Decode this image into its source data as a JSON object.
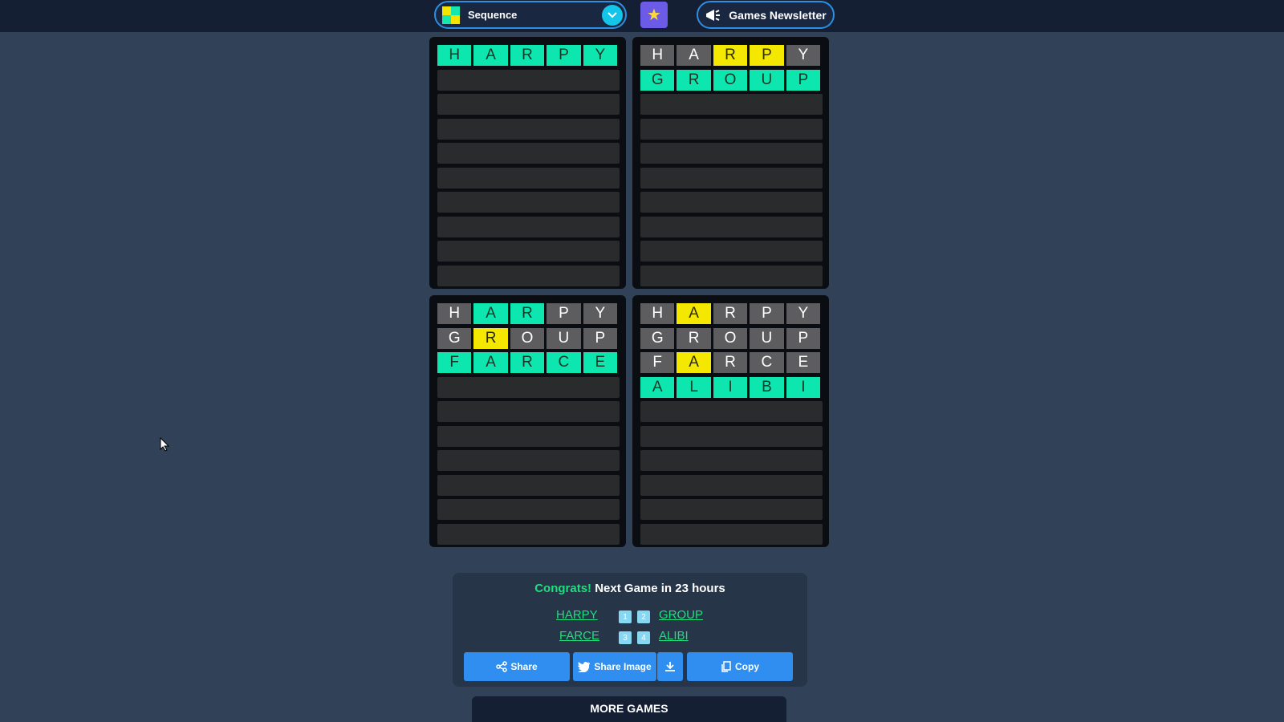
{
  "header": {
    "game_name": "Sequence",
    "newsletter_label": "Games Newsletter"
  },
  "boards": [
    {
      "rows": [
        [
          {
            "l": "H",
            "s": "green"
          },
          {
            "l": "A",
            "s": "green"
          },
          {
            "l": "R",
            "s": "green"
          },
          {
            "l": "P",
            "s": "green"
          },
          {
            "l": "Y",
            "s": "green"
          }
        ]
      ],
      "empty_rows": 9
    },
    {
      "rows": [
        [
          {
            "l": "H",
            "s": "gray"
          },
          {
            "l": "A",
            "s": "gray"
          },
          {
            "l": "R",
            "s": "yellow"
          },
          {
            "l": "P",
            "s": "yellow"
          },
          {
            "l": "Y",
            "s": "gray"
          }
        ],
        [
          {
            "l": "G",
            "s": "green"
          },
          {
            "l": "R",
            "s": "green"
          },
          {
            "l": "O",
            "s": "green"
          },
          {
            "l": "U",
            "s": "green"
          },
          {
            "l": "P",
            "s": "green"
          }
        ]
      ],
      "empty_rows": 8
    },
    {
      "rows": [
        [
          {
            "l": "H",
            "s": "gray"
          },
          {
            "l": "A",
            "s": "green"
          },
          {
            "l": "R",
            "s": "green"
          },
          {
            "l": "P",
            "s": "gray"
          },
          {
            "l": "Y",
            "s": "gray"
          }
        ],
        [
          {
            "l": "G",
            "s": "gray"
          },
          {
            "l": "R",
            "s": "yellow"
          },
          {
            "l": "O",
            "s": "gray"
          },
          {
            "l": "U",
            "s": "gray"
          },
          {
            "l": "P",
            "s": "gray"
          }
        ],
        [
          {
            "l": "F",
            "s": "green"
          },
          {
            "l": "A",
            "s": "green"
          },
          {
            "l": "R",
            "s": "green"
          },
          {
            "l": "C",
            "s": "green"
          },
          {
            "l": "E",
            "s": "green"
          }
        ]
      ],
      "empty_rows": 7
    },
    {
      "rows": [
        [
          {
            "l": "H",
            "s": "gray"
          },
          {
            "l": "A",
            "s": "yellow"
          },
          {
            "l": "R",
            "s": "gray"
          },
          {
            "l": "P",
            "s": "gray"
          },
          {
            "l": "Y",
            "s": "gray"
          }
        ],
        [
          {
            "l": "G",
            "s": "gray"
          },
          {
            "l": "R",
            "s": "gray"
          },
          {
            "l": "O",
            "s": "gray"
          },
          {
            "l": "U",
            "s": "gray"
          },
          {
            "l": "P",
            "s": "gray"
          }
        ],
        [
          {
            "l": "F",
            "s": "gray"
          },
          {
            "l": "A",
            "s": "yellow"
          },
          {
            "l": "R",
            "s": "gray"
          },
          {
            "l": "C",
            "s": "gray"
          },
          {
            "l": "E",
            "s": "gray"
          }
        ],
        [
          {
            "l": "A",
            "s": "green"
          },
          {
            "l": "L",
            "s": "green"
          },
          {
            "l": "I",
            "s": "green"
          },
          {
            "l": "B",
            "s": "green"
          },
          {
            "l": "I",
            "s": "green"
          }
        ]
      ],
      "empty_rows": 6
    }
  ],
  "result": {
    "congrats": "Congrats!",
    "next_game": "Next Game in 23 hours",
    "words": [
      "HARPY",
      "GROUP",
      "FARCE",
      "ALIBI"
    ],
    "badges": [
      "1",
      "2",
      "3",
      "4"
    ]
  },
  "actions": {
    "share": "Share",
    "share_image": "Share Image",
    "copy": "Copy"
  },
  "footer": {
    "more_games": "MORE GAMES"
  },
  "colors": {
    "green": "#0ee6b0",
    "yellow": "#f5e800",
    "gray": "#5d5d5f",
    "link": "#1edf7c",
    "button": "#2f8ef0"
  }
}
